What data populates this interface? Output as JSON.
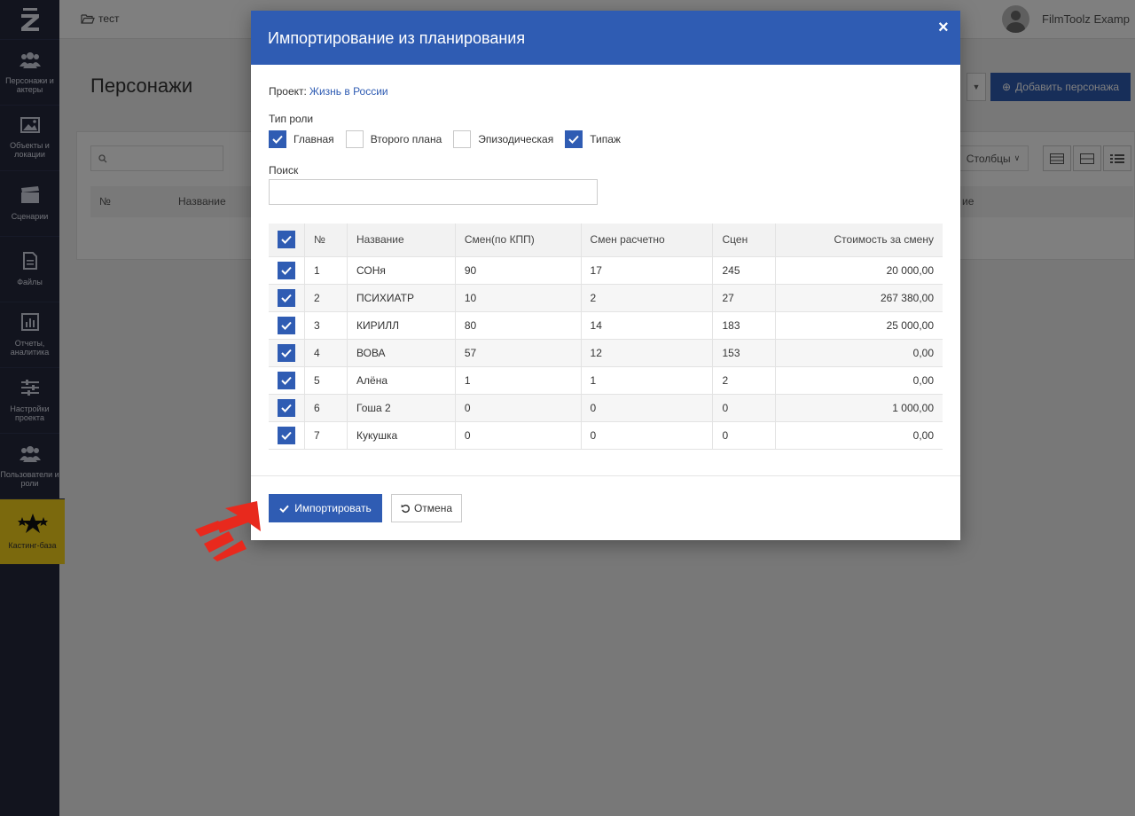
{
  "sidebar": {
    "logo": "Z",
    "items": [
      {
        "label": "Персонажи и\nактеры",
        "icon": "users-icon"
      },
      {
        "label": "Объекты и\nлокации",
        "icon": "image-icon"
      },
      {
        "label": "Сценарии",
        "icon": "clapperboard-icon"
      },
      {
        "label": "Файлы",
        "icon": "file-icon"
      },
      {
        "label": "Отчеты,\nаналитика",
        "icon": "bar-chart-icon"
      },
      {
        "label": "Настройки\nпроекта",
        "icon": "sliders-icon"
      },
      {
        "label": "Пользователи и\nроли",
        "icon": "users-icon"
      },
      {
        "label": "Кастинг-база",
        "icon": "stars-icon",
        "active": true
      }
    ]
  },
  "topbar": {
    "breadcrumb": "тест",
    "user_name": "FilmToolz Examp"
  },
  "page": {
    "title": "Персонажи",
    "add_button": "Добавить персонажа",
    "columns_button": "Столбцы",
    "bg_headers": [
      "№",
      "Название",
      "ие"
    ]
  },
  "modal": {
    "title": "Импортирование из планирования",
    "close": "×",
    "project_label": "Проект:",
    "project_name": "Жизнь в России",
    "role_label": "Тип роли",
    "roles": [
      {
        "label": "Главная",
        "checked": true
      },
      {
        "label": "Второго плана",
        "checked": false
      },
      {
        "label": "Эпизодическая",
        "checked": false
      },
      {
        "label": "Типаж",
        "checked": true
      }
    ],
    "search_label": "Поиск",
    "search_value": "",
    "table": {
      "headers": [
        "№",
        "Название",
        "Смен(по КПП)",
        "Смен расчетно",
        "Сцен",
        "Стоимость за смену"
      ],
      "rows": [
        [
          "1",
          "СОНя",
          "90",
          "17",
          "245",
          "20 000,00"
        ],
        [
          "2",
          "ПСИХИАТР",
          "10",
          "2",
          "27",
          "267 380,00"
        ],
        [
          "3",
          "КИРИЛЛ",
          "80",
          "14",
          "183",
          "25 000,00"
        ],
        [
          "4",
          "ВОВА",
          "57",
          "12",
          "153",
          "0,00"
        ],
        [
          "5",
          "Алёна",
          "1",
          "1",
          "2",
          "0,00"
        ],
        [
          "6",
          "Гоша 2",
          "0",
          "0",
          "0",
          "1 000,00"
        ],
        [
          "7",
          "Кукушка",
          "0",
          "0",
          "0",
          "0,00"
        ]
      ]
    },
    "import_button": "Импортировать",
    "cancel_button": "Отмена"
  },
  "colors": {
    "primary": "#2f5cb3",
    "sidebar": "#24283d",
    "active": "#f7d21b",
    "annotation_arrow": "#e8291d"
  }
}
